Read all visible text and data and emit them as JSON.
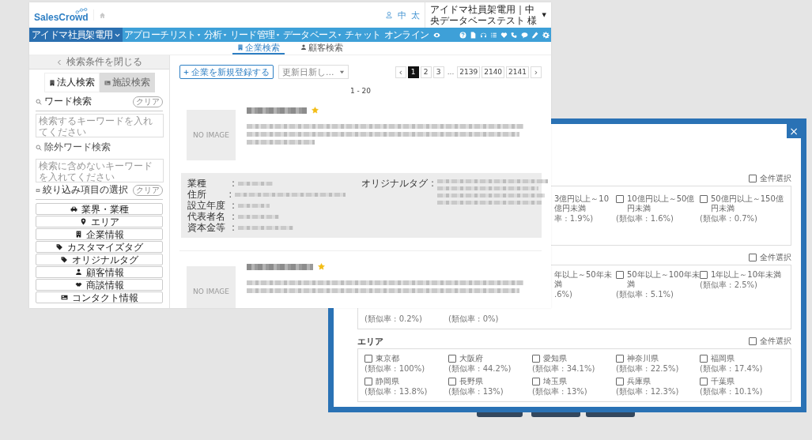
{
  "header": {
    "logo": "SalesCrowd",
    "icon_texts": [
      "中",
      "太"
    ],
    "user": "アイドマ社員架電用｜中央データベーステスト 様",
    "user_caret": "▼"
  },
  "nav": {
    "account": {
      "label": "アイドマ社員架電用",
      "dropdown": true
    },
    "items": [
      {
        "label": "アプローチリスト",
        "dropdown": true
      },
      {
        "label": "分析",
        "dropdown": true
      },
      {
        "label": "リード管理",
        "dropdown": true
      },
      {
        "label": "データベース",
        "dropdown": true
      },
      {
        "label": "チャット",
        "dropdown": false
      },
      {
        "label": "オンライン",
        "dropdown": false
      }
    ]
  },
  "search_tabs": [
    {
      "label": "企業検索",
      "selected": true
    },
    {
      "label": "顧客検索",
      "selected": false
    }
  ],
  "sidebar": {
    "close": "検索条件を閉じる",
    "modes": [
      {
        "label": "法人検索",
        "selected": true
      },
      {
        "label": "施設検索",
        "selected": false
      }
    ],
    "word_search": {
      "title": "ワード検索",
      "clear": "クリア",
      "placeholder": "検索するキーワードを入れてください"
    },
    "exclude_search": {
      "title": "除外ワード検索",
      "placeholder": "検索に含めないキーワードを入れてください"
    },
    "filters": {
      "title": "絞り込み項目の選択",
      "clear": "クリア",
      "items": [
        "業界・業種",
        "エリア",
        "企業情報",
        "カスタマイズタグ",
        "オリジナルタグ",
        "顧客情報",
        "商談情報",
        "コンタクト情報"
      ]
    }
  },
  "toolbar": {
    "add": "企業を新規登録する",
    "sort": "更新日新し...",
    "pages": [
      {
        "label": "‹",
        "kind": "arrow"
      },
      {
        "label": "1",
        "kind": "page",
        "selected": true
      },
      {
        "label": "2",
        "kind": "page",
        "selected": false
      },
      {
        "label": "3",
        "kind": "page",
        "selected": false
      },
      {
        "label": "...",
        "kind": "gap"
      },
      {
        "label": "2139",
        "kind": "page",
        "selected": false
      },
      {
        "label": "2140",
        "kind": "page",
        "selected": false
      },
      {
        "label": "2141",
        "kind": "page",
        "selected": false
      },
      {
        "label": "›",
        "kind": "arrow"
      }
    ]
  },
  "range": "1 - 20",
  "cards": [
    {
      "image": "NO IMAGE",
      "favorite": true,
      "details": {
        "labels": [
          "業種",
          "住所",
          "設立年度",
          "代表者名",
          "資本金等"
        ],
        "separator": ":",
        "tag_label": "オリジナルタグ"
      }
    },
    {
      "image": "NO IMAGE",
      "favorite": true
    }
  ],
  "modal": {
    "close": "×",
    "sections": [
      {
        "select_all": {
          "label": "全件選択",
          "checked": false
        },
        "items": [
          {
            "kind": "partial",
            "label": "3億円以上～10億円未満",
            "rate": "率 : 1.9%)"
          },
          {
            "kind": "option",
            "label": "10億円以上～50億円未満",
            "rate": "(類似率 : 1.6%)",
            "checked": false
          },
          {
            "kind": "option",
            "label": "50億円以上～150億円未満",
            "rate": "(類似率 : 0.7%)",
            "checked": false
          }
        ]
      },
      {
        "select_all": {
          "label": "全件選択",
          "checked": false
        },
        "items": [
          {
            "kind": "partial",
            "label": "年以上～50年未満",
            "rate": ".6%)"
          },
          {
            "kind": "option",
            "label": "50年以上～100年未満",
            "rate": "(類似率 : 5.1%)",
            "checked": false
          },
          {
            "kind": "option",
            "label": "1年以上～10年未満",
            "rate": "(類似率 : 2.5%)",
            "checked": false
          },
          {
            "kind": "rate",
            "rate": "(類似率 : 0.2%)"
          },
          {
            "kind": "rate",
            "rate": "(類似率 : 0%)"
          }
        ]
      },
      {
        "title": "エリア",
        "select_all": {
          "label": "全件選択",
          "checked": false
        },
        "items": [
          {
            "kind": "option",
            "label": "東京都",
            "rate": "(類似率 : 100%)",
            "checked": false
          },
          {
            "kind": "option",
            "label": "大阪府",
            "rate": "(類似率 : 44.2%)",
            "checked": false
          },
          {
            "kind": "option",
            "label": "愛知県",
            "rate": "(類似率 : 34.1%)",
            "checked": false
          },
          {
            "kind": "option",
            "label": "神奈川県",
            "rate": "(類似率 : 22.5%)",
            "checked": false
          },
          {
            "kind": "option",
            "label": "福岡県",
            "rate": "(類似率 : 17.4%)",
            "checked": false
          },
          {
            "kind": "option",
            "label": "静岡県",
            "rate": "(類似率 : 13.8%)",
            "checked": false
          },
          {
            "kind": "option",
            "label": "長野県",
            "rate": "(類似率 : 13%)",
            "checked": false
          },
          {
            "kind": "option",
            "label": "埼玉県",
            "rate": "(類似率 : 13%)",
            "checked": false
          },
          {
            "kind": "option",
            "label": "兵庫県",
            "rate": "(類似率 : 12.3%)",
            "checked": false
          },
          {
            "kind": "option",
            "label": "千葉県",
            "rate": "(類似率 : 10.1%)",
            "checked": false
          }
        ]
      }
    ]
  }
}
